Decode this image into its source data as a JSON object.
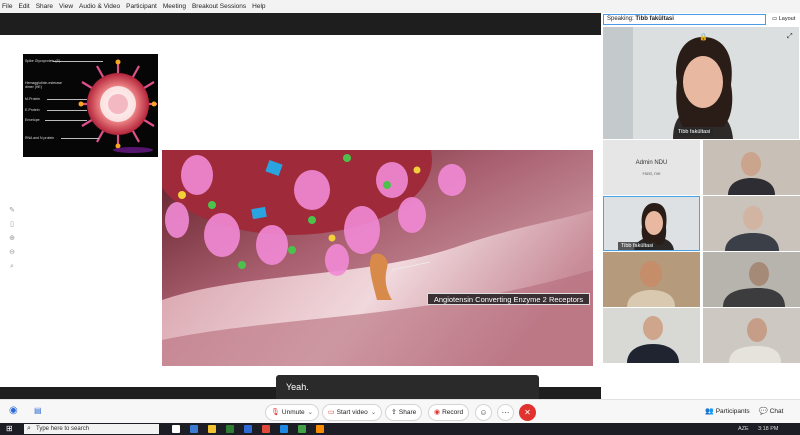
{
  "menubar": {
    "items": [
      "File",
      "Edit",
      "Share",
      "View",
      "Audio & Video",
      "Participant",
      "Meeting",
      "Breakout Sessions",
      "Help"
    ]
  },
  "slide": {
    "inset_labels": [
      "Spike Glycoprotein (S)",
      "Hemagglutinin-esterase dimer (HE)",
      "M-Protein",
      "E-Protein",
      "Envelope",
      "RNA and N protein"
    ],
    "annotation": "Angiotensin Converting Enzyme 2 Receptors"
  },
  "caption": {
    "text": "Yeah."
  },
  "right_panel": {
    "speaking_label": "Speaking:",
    "speaking_name": "Tibb fakültasi",
    "layout_label": "Layout",
    "speaker_name": "Tibb fakültasi",
    "admin_name": "Admin NDU",
    "admin_sub": "Host, me",
    "selected_tile_name": "Tibb fakültasi"
  },
  "toolbar": {
    "unmute": "Unmute",
    "start_video": "Start video",
    "share": "Share",
    "record": "Record",
    "participants": "Participants",
    "chat": "Chat"
  },
  "taskbar": {
    "search_placeholder": "Type here to search",
    "time": "3:18 PM",
    "lang": "AZE"
  },
  "colors": {
    "accent_blue": "#4aa3e6",
    "leave_red": "#e0322e",
    "record_red": "#e0322e"
  },
  "icons": [
    "search-icon",
    "windows-icon",
    "microphone-icon",
    "video-icon",
    "share-icon",
    "record-icon",
    "reactions-icon",
    "more-icon",
    "close-icon",
    "participants-icon",
    "chat-icon",
    "layout-icon",
    "lock-icon",
    "expand-icon"
  ]
}
